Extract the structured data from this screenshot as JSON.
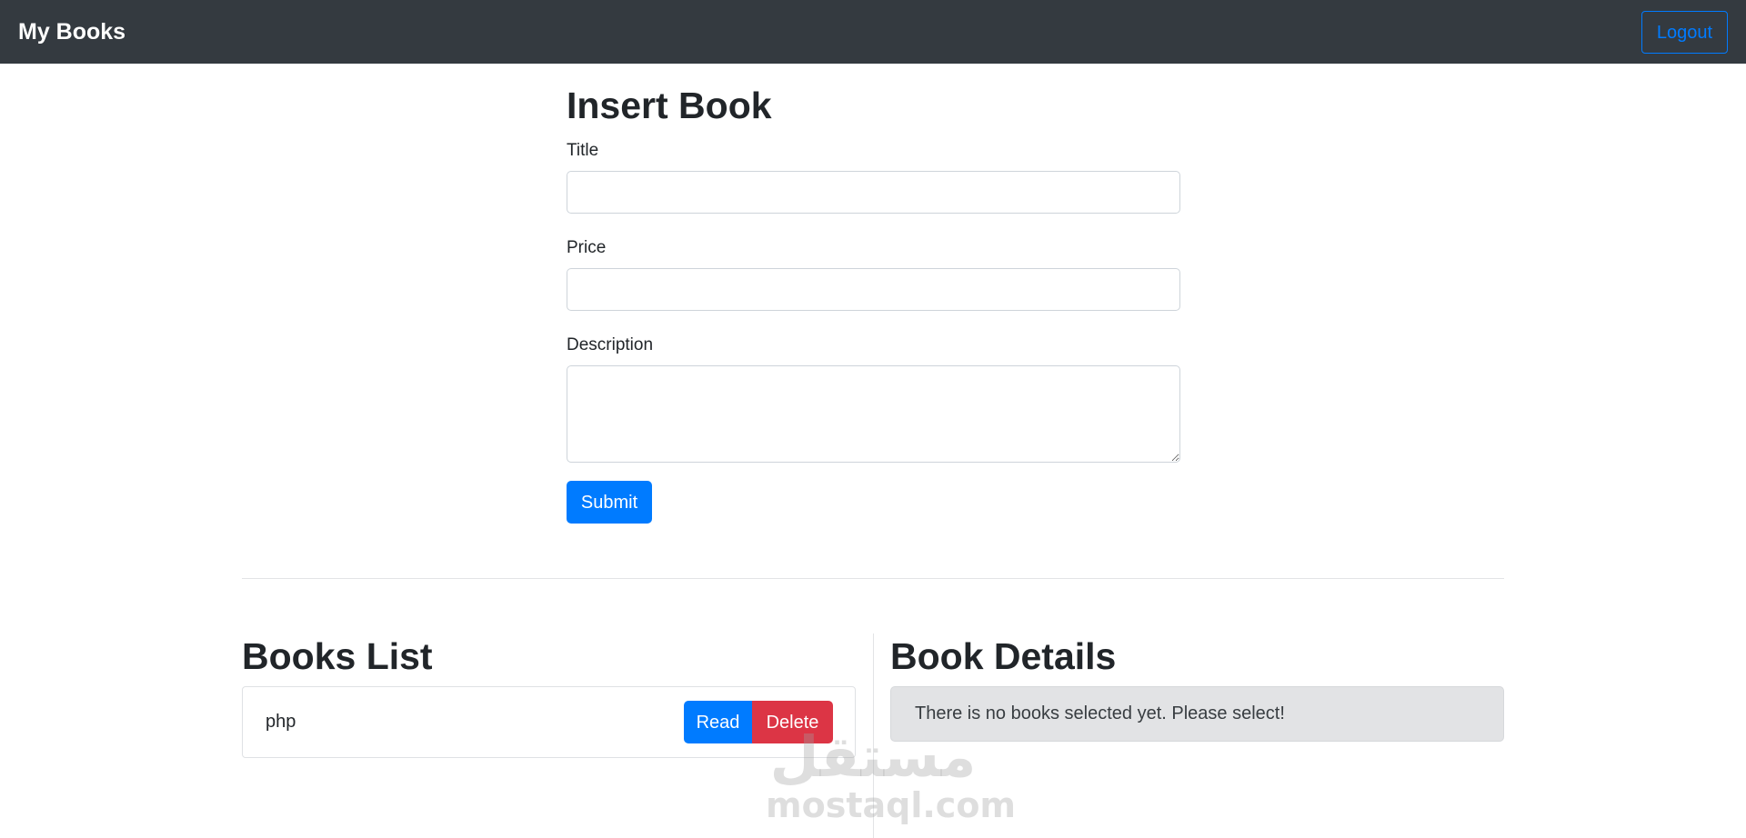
{
  "navbar": {
    "brand": "My Books",
    "logout_label": "Logout"
  },
  "insert_form": {
    "title": "Insert Book",
    "fields": {
      "title_label": "Title",
      "title_value": "",
      "price_label": "Price",
      "price_value": "",
      "description_label": "Description",
      "description_value": ""
    },
    "submit_label": "Submit"
  },
  "books_list": {
    "title": "Books List",
    "items": [
      {
        "title": "php",
        "read_label": "Read",
        "delete_label": "Delete"
      }
    ]
  },
  "book_details": {
    "title": "Book Details",
    "empty_message": "There is no books selected yet. Please select!"
  },
  "watermark": {
    "arabic": "مستقل",
    "latin": "mostaql.com"
  },
  "colors": {
    "navbar_bg": "#343a40",
    "primary": "#007bff",
    "danger": "#dc3545",
    "alert_bg": "#e2e3e5"
  }
}
